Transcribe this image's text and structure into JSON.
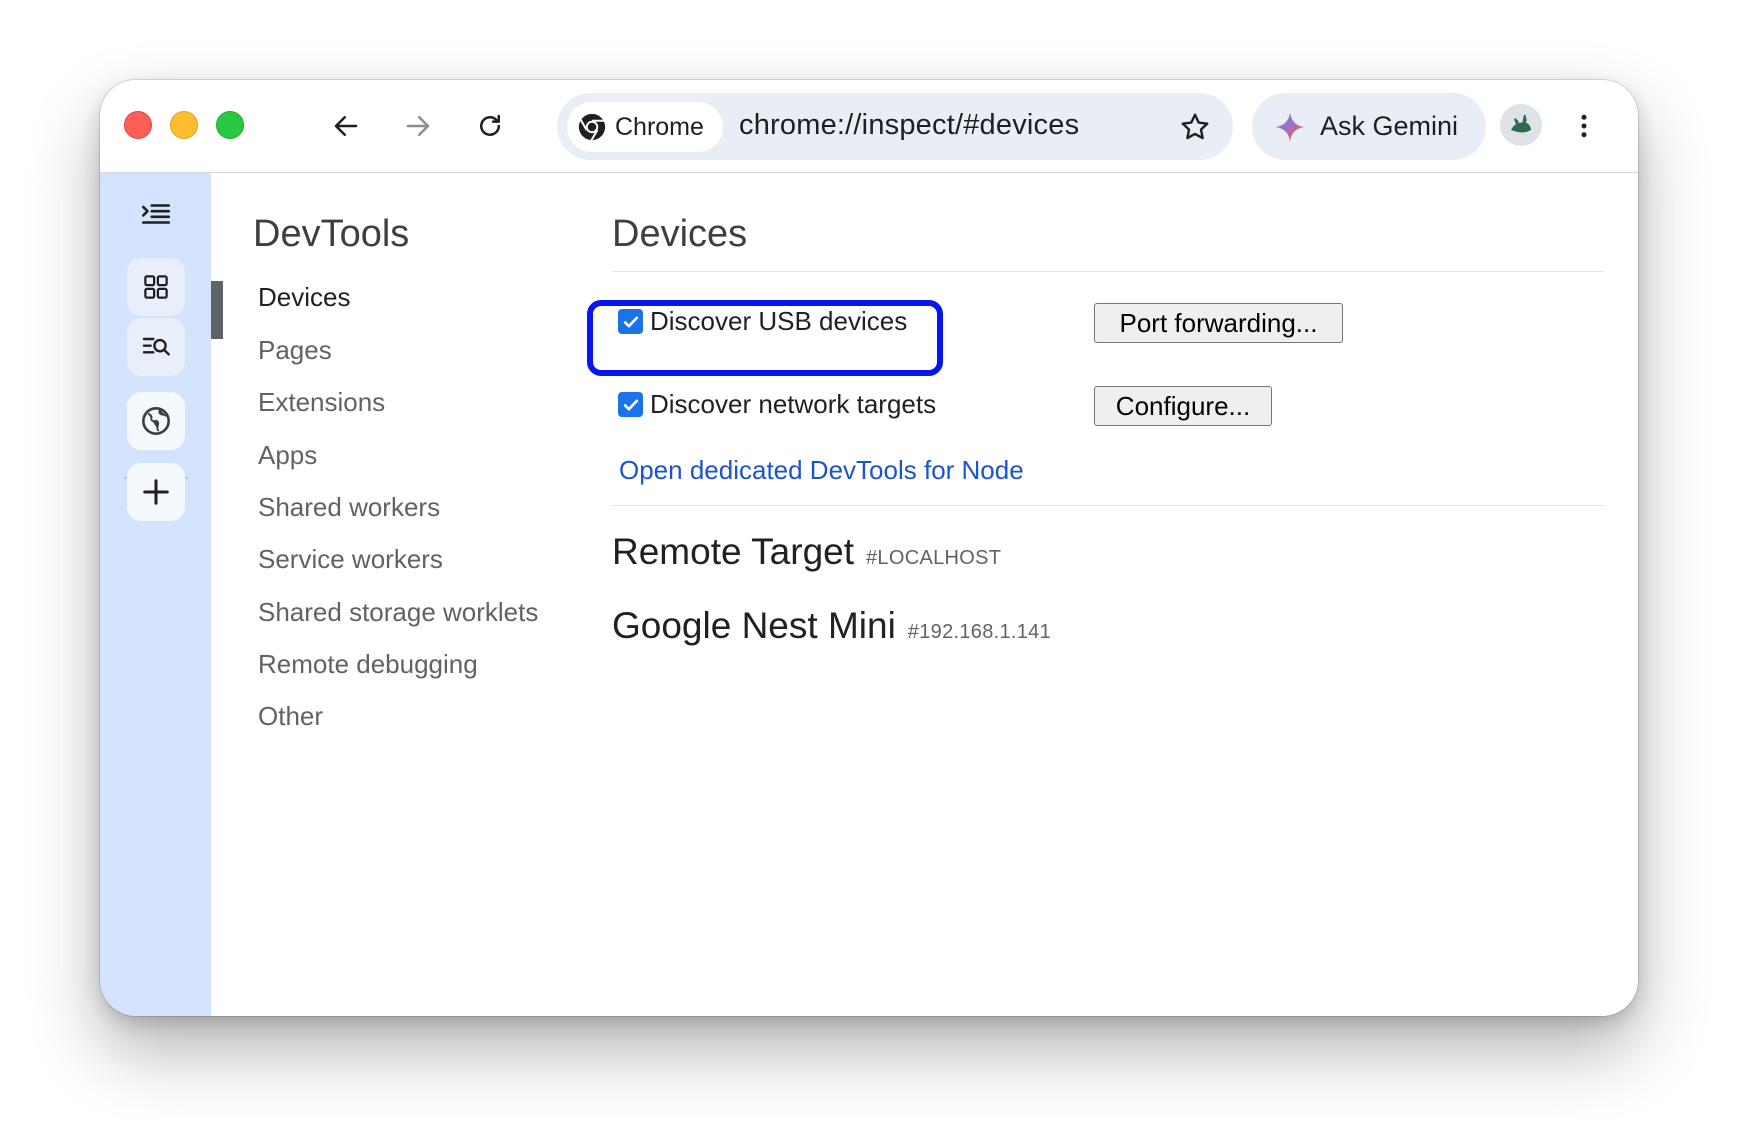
{
  "window": {
    "traffic_lights": [
      "close",
      "minimize",
      "zoom"
    ]
  },
  "toolbar": {
    "back_icon": "arrow-left",
    "forward_icon": "arrow-right",
    "reload_icon": "reload",
    "omnibox": {
      "chip_label": "Chrome",
      "url": "chrome://inspect/#devices",
      "bookmark_icon": "star"
    },
    "gemini_label": "Ask Gemini",
    "menu_icon": "three-dots-vertical"
  },
  "rail": {
    "items": [
      "collapse-panel",
      "tab-grid",
      "search-tabs",
      "globe",
      "add"
    ]
  },
  "sidebar": {
    "title": "DevTools",
    "active": "Devices",
    "items": [
      "Devices",
      "Pages",
      "Extensions",
      "Apps",
      "Shared workers",
      "Service workers",
      "Shared storage worklets",
      "Remote debugging",
      "Other"
    ]
  },
  "main": {
    "title": "Devices",
    "discover_usb": {
      "label": "Discover USB devices",
      "checked": true
    },
    "discover_network": {
      "label": "Discover network targets",
      "checked": true
    },
    "port_forwarding_button": "Port forwarding...",
    "configure_button": "Configure...",
    "node_link": "Open dedicated DevTools for Node",
    "targets": [
      {
        "name": "Remote Target",
        "tag": "#LOCALHOST"
      },
      {
        "name": "Google Nest Mini",
        "tag": "#192.168.1.141"
      }
    ]
  },
  "colors": {
    "highlight_border": "#0716f0",
    "checkbox": "#1a73e8",
    "link": "#1a55c9",
    "rail_bg": "#d3e3fd"
  }
}
